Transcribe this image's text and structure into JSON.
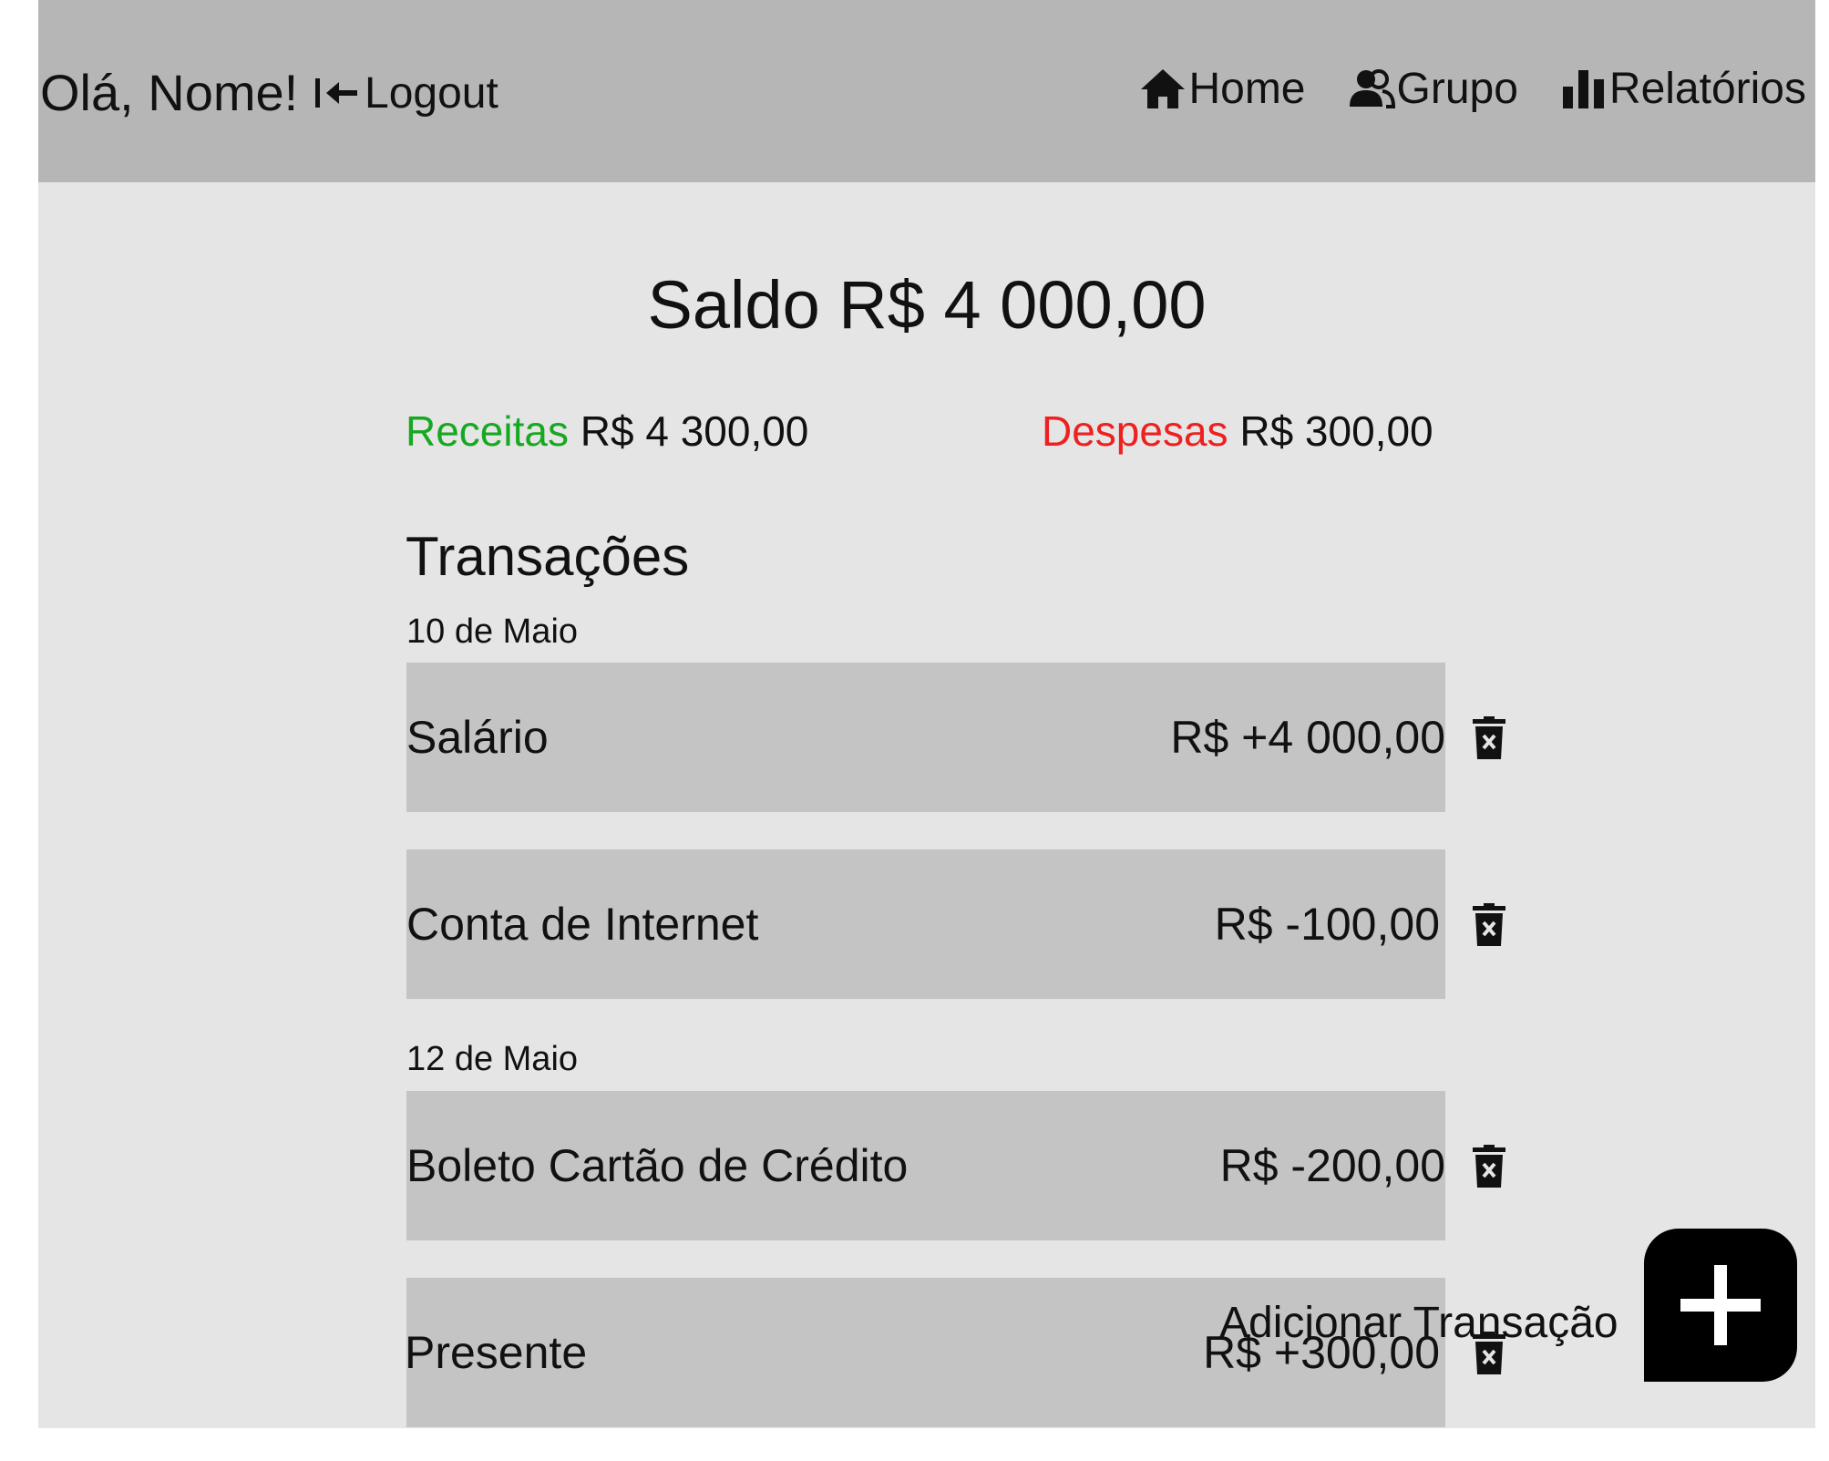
{
  "header": {
    "greeting": "Olá, Nome!",
    "logout_label": "Logout",
    "nav": [
      {
        "label": "Home",
        "icon": "home-icon"
      },
      {
        "label": "Grupo",
        "icon": "group-icon"
      },
      {
        "label": "Relatórios",
        "icon": "bar-chart-icon"
      }
    ]
  },
  "balance": {
    "label": "Saldo",
    "value": "R$ 4 000,00"
  },
  "summary": {
    "income_label": "Receitas",
    "income_value": "R$ 4 300,00",
    "expense_label": "Despesas",
    "expense_value": "R$ 300,00"
  },
  "transactions": {
    "title": "Transações",
    "groups": [
      {
        "date": "10 de Maio",
        "items": [
          {
            "description": "Salário",
            "amount": "R$ +4 000,00"
          },
          {
            "description": "Conta de Internet",
            "amount": "R$ -100,00"
          }
        ]
      },
      {
        "date": "12 de Maio",
        "items": [
          {
            "description": "Boleto Cartão de Crédito",
            "amount": "R$ -200,00"
          },
          {
            "description": "Presente",
            "amount": "R$ +300,00"
          }
        ]
      }
    ]
  },
  "add_button": {
    "label": "Adicionar Transação",
    "icon": "plus-icon"
  },
  "colors": {
    "header_bg": "#b6b6b6",
    "page_bg": "#e5e5e5",
    "row_bg": "#c4c4c4",
    "income": "#17a821",
    "expense": "#ee2020"
  }
}
